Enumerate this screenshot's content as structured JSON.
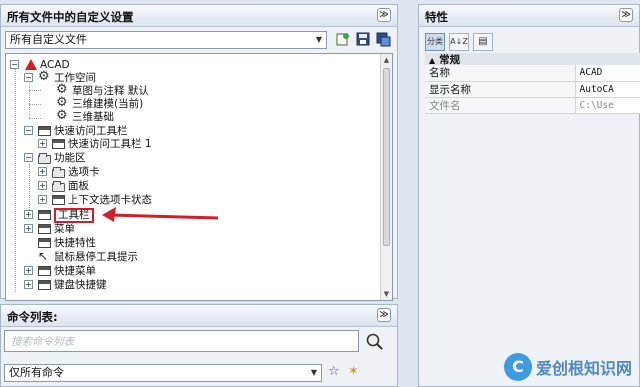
{
  "left_panel": {
    "title": "所有文件中的自定义设置",
    "collapse_glyph": "≫",
    "filter_value": "所有自定义文件",
    "toolbar_icons": [
      "add-file-icon",
      "save-icon",
      "save-as-icon"
    ],
    "tree": [
      {
        "label": "ACAD",
        "icon": "acad-icon"
      },
      {
        "label": "工作空间",
        "icon": "gear-icon"
      },
      {
        "label": "草图与注释 默认",
        "icon": "gear-icon"
      },
      {
        "label": "三维建模(当前)",
        "icon": "gear-icon"
      },
      {
        "label": "三维基础",
        "icon": "gear-icon"
      },
      {
        "label": "快速访问工具栏",
        "icon": "toolbar-icon"
      },
      {
        "label": "快速访问工具栏 1",
        "icon": "toolbar-icon"
      },
      {
        "label": "功能区",
        "icon": "folder-icon"
      },
      {
        "label": "选项卡",
        "icon": "folder-icon"
      },
      {
        "label": "面板",
        "icon": "folder-icon"
      },
      {
        "label": "上下文选项卡状态",
        "icon": "window-icon"
      },
      {
        "label": "工具栏",
        "icon": "toolbar-icon"
      },
      {
        "label": "菜单",
        "icon": "menu-icon"
      },
      {
        "label": "快捷特性",
        "icon": "window-icon"
      },
      {
        "label": "鼠标悬停工具提示",
        "icon": "cursor-icon"
      },
      {
        "label": "快捷菜单",
        "icon": "menu-icon"
      },
      {
        "label": "键盘快捷键",
        "icon": "keyboard-icon"
      }
    ],
    "highlight_color": "#d11f2a"
  },
  "command_panel": {
    "title": "命令列表:",
    "collapse_glyph": "≫",
    "search_placeholder": "搜索命令列表",
    "filter_value": "仅所有命令"
  },
  "props_panel": {
    "title": "特性",
    "collapse_glyph": "≫",
    "toolbar": [
      "分类",
      "A↓Z",
      "▤"
    ],
    "category": "常规",
    "rows": [
      {
        "key": "名称",
        "value": "ACAD"
      },
      {
        "key": "显示名称",
        "value": "AutoCA"
      },
      {
        "key": "文件名",
        "value": "C:\\Use"
      }
    ]
  },
  "watermark": {
    "mark": "C",
    "text": "爱创根知识网"
  }
}
